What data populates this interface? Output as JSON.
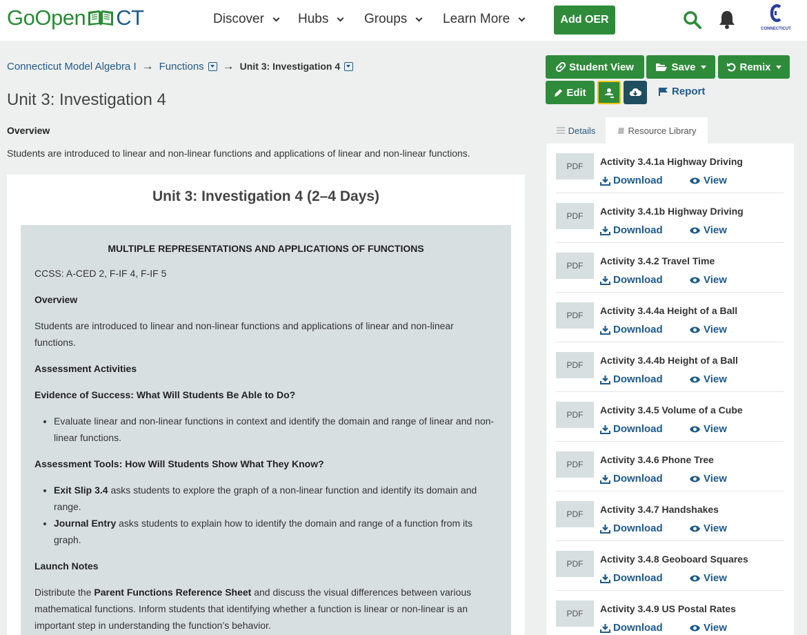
{
  "header": {
    "logo": {
      "go_open": "GoOpen",
      "ct": "CT"
    },
    "nav": [
      {
        "label": "Discover"
      },
      {
        "label": "Hubs"
      },
      {
        "label": "Groups"
      },
      {
        "label": "Learn More"
      }
    ],
    "add_oer_label": "Add OER",
    "profile_logo_text": "CONNECTICUT"
  },
  "breadcrumb": {
    "items": [
      "Connecticut Model Algebra I",
      "Functions",
      "Unit 3: Investigation 4"
    ],
    "separator": "→"
  },
  "page": {
    "title": "Unit 3: Investigation 4",
    "overview_label": "Overview",
    "overview_text": "Students are introduced to linear and non-linear functions and applications of linear and non-linear functions."
  },
  "content": {
    "card_title": "Unit 3: Investigation 4 (2–4 Days)",
    "section_title": "MULTIPLE REPRESENTATIONS AND APPLICATIONS OF FUNCTIONS",
    "ccss": "CCSS:  A-CED 2, F-IF 4, F-IF 5",
    "overview_heading": "Overview",
    "overview_text": "Students are introduced to linear and non-linear functions and applications of linear and non-linear functions.",
    "assessment_heading": "Assessment Activities",
    "evidence_heading": "Evidence of Success: What Will Students Be Able to Do?",
    "evidence_bullet": "Evaluate linear and non-linear functions in context and identify the domain and range of linear and non-linear functions.",
    "tools_heading": "Assessment Tools:  How Will Students Show What They Know?",
    "tool1_bold": "Exit Slip 3.4",
    "tool1_text": " asks students to explore the graph of a non-linear function and identify its domain and range.",
    "tool2_bold": "Journal Entry",
    "tool2_text": " asks students to explain how to identify the domain and range of a function from its graph.",
    "launch_heading": "Launch Notes",
    "launch_pre": "Distribute the ",
    "launch_bold": "Parent Functions Reference Sheet",
    "launch_post": " and discuss the visual differences between various mathematical functions. Inform students that identifying whether a function is linear or non-linear is an important step in understanding the function’s behavior."
  },
  "toolbar": {
    "student_view": "Student View",
    "save": "Save",
    "remix": "Remix",
    "edit": "Edit",
    "report": "Report"
  },
  "tabs": {
    "details": "Details",
    "library": "Resource Library"
  },
  "resources": {
    "thumb_label": "PDF",
    "download_label": "Download",
    "view_label": "View",
    "items": [
      {
        "title": "Activity 3.4.1a Highway Driving"
      },
      {
        "title": "Activity 3.4.1b Highway Driving"
      },
      {
        "title": "Activity 3.4.2 Travel Time"
      },
      {
        "title": "Activity 3.4.4a Height of a Ball"
      },
      {
        "title": "Activity 3.4.4b Height of a Ball"
      },
      {
        "title": "Activity 3.4.5 Volume of a Cube"
      },
      {
        "title": "Activity 3.4.6 Phone Tree"
      },
      {
        "title": "Activity 3.4.7 Handshakes"
      },
      {
        "title": "Activity 3.4.8 Geoboard Squares"
      },
      {
        "title": "Activity 3.4.9 US Postal Rates"
      }
    ]
  },
  "colors": {
    "brand_green": "#2e8b3a",
    "link_blue": "#1e5a8a",
    "dark_teal": "#1f4e5f",
    "highlight_yellow": "#f0c400"
  }
}
